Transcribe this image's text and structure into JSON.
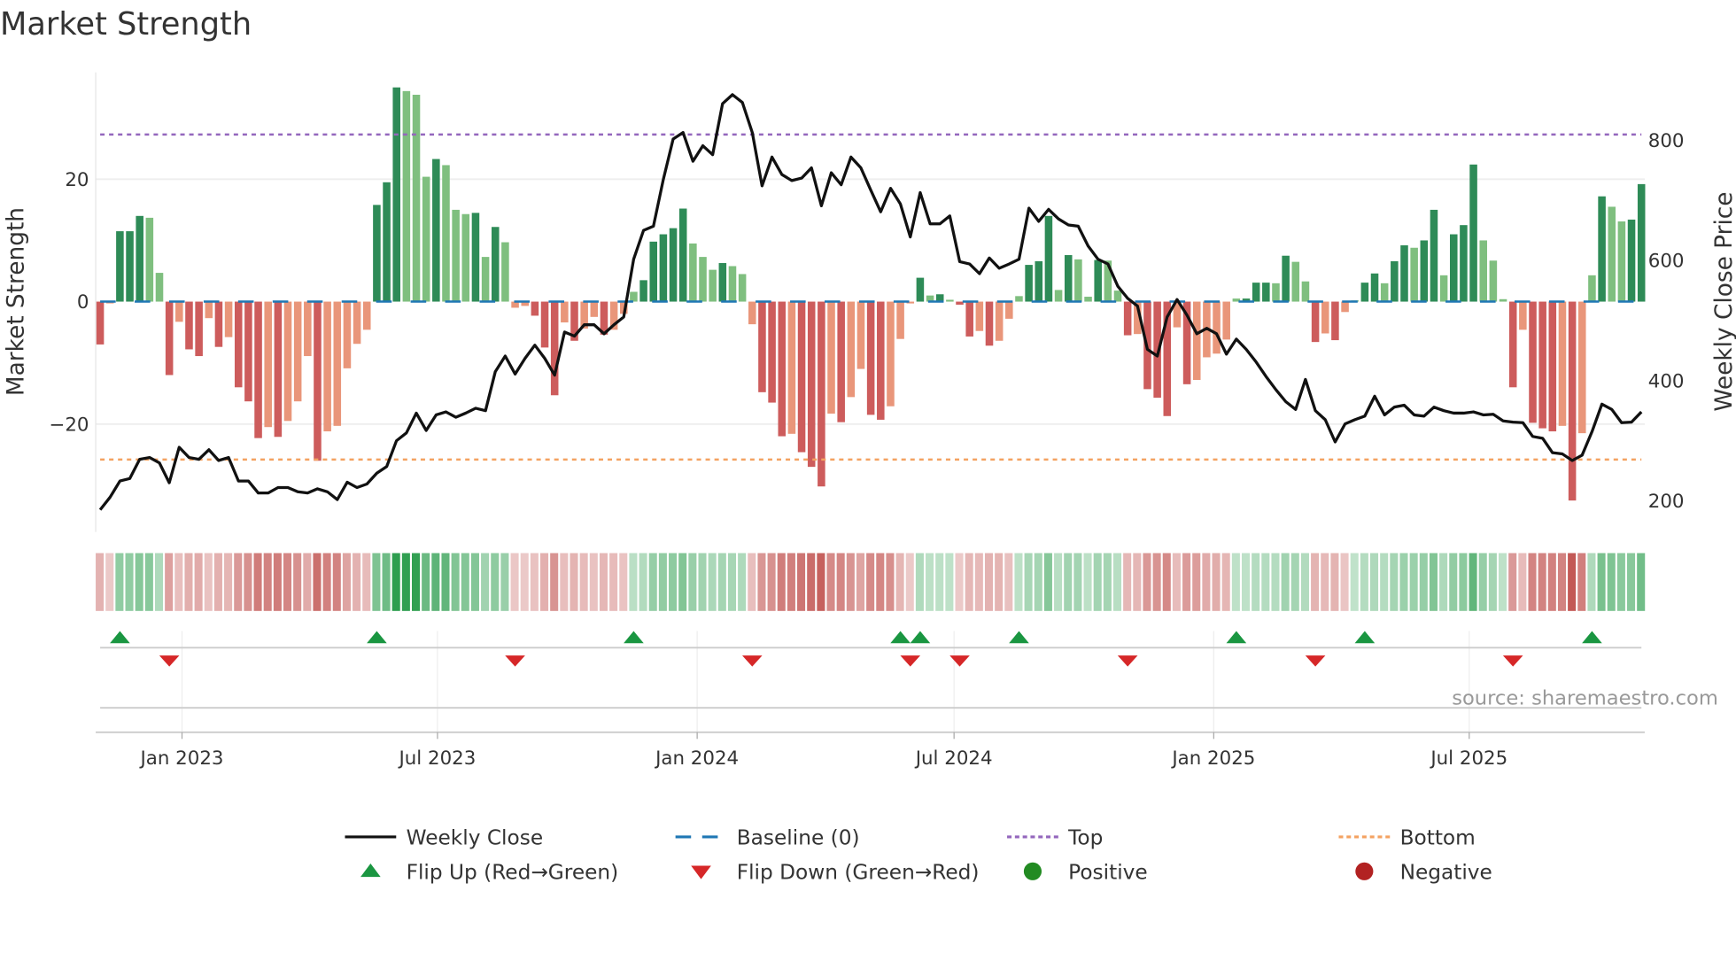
{
  "chart_data": {
    "type": "bar",
    "title": "Market Strength",
    "ylabel": "Market Strength",
    "y2label": "Weekly Close Price",
    "ylim": [
      -37,
      38
    ],
    "y2lim": [
      128,
      1028
    ],
    "x_start": "2022-11-04",
    "x_frequency": "weekly",
    "x_ticks": [
      "Jan 2023",
      "Jul 2023",
      "Jan 2024",
      "Jul 2024",
      "Jan 2025",
      "Jul 2025"
    ],
    "x_tick_dates": [
      "2023-01-01",
      "2023-07-01",
      "2024-01-01",
      "2024-07-01",
      "2025-01-01",
      "2025-07-01"
    ],
    "y_ticks": [
      "−20",
      "0",
      "20"
    ],
    "y_tick_values": [
      -20,
      0,
      20
    ],
    "y2_ticks": [
      "200",
      "400",
      "600",
      "800"
    ],
    "y2_tick_values": [
      200,
      400,
      600,
      800
    ],
    "top_level": 27.3,
    "bottom_level": -25.8,
    "baseline": 0,
    "grid": true,
    "legend_position": "bottom",
    "source_text": "source: sharemaestro.com",
    "series": [
      {
        "name": "Market Strength",
        "type": "bar",
        "values": [
          -7,
          -0.3,
          11.5,
          11.5,
          14,
          13.7,
          4.7,
          -12,
          -3.3,
          -7.8,
          -8.9,
          -2.7,
          -7.4,
          -5.8,
          -14,
          -16.3,
          -22.3,
          -20.5,
          -22.1,
          -19.5,
          -16.3,
          -8.9,
          -26,
          -21.2,
          -20.3,
          -10.9,
          -6.9,
          -4.6,
          15.8,
          19.5,
          35,
          34.4,
          33.8,
          20.4,
          23.3,
          22.3,
          15,
          14.3,
          14.5,
          7.3,
          12.2,
          9.7,
          -1,
          -0.7,
          -2.3,
          -7.5,
          -15.3,
          -3.4,
          -6.4,
          -4.4,
          -2.5,
          -5.4,
          -4.6,
          -2,
          1.6,
          3.5,
          9.8,
          11,
          12,
          15.2,
          9.5,
          7.3,
          5.2,
          6.3,
          5.8,
          4.5,
          -3.7,
          -14.8,
          -16.5,
          -22,
          -21.6,
          -24.6,
          -27,
          -30.2,
          -18.3,
          -19.7,
          -15.6,
          -11,
          -18.5,
          -19.3,
          -17.1,
          -6.1,
          -0.3,
          3.9,
          1,
          1.2,
          0.3,
          -0.5,
          -5.7,
          -4.8,
          -7.2,
          -6.4,
          -2.8,
          0.9,
          6,
          6.6,
          14,
          1.9,
          7.6,
          6.9,
          0.8,
          6.8,
          6.7,
          1.8,
          -5.5,
          -5.3,
          -14.3,
          -15.7,
          -18.7,
          -4.2,
          -13.5,
          -12.8,
          -9.1,
          -8.5,
          -6.2,
          0.5,
          0.5,
          3.1,
          3.1,
          3,
          7.5,
          6.5,
          3.3,
          -6.6,
          -5.2,
          -6.3,
          -1.7,
          0.2,
          3.1,
          4.6,
          3,
          6.6,
          9.2,
          8.8,
          10,
          15,
          4.3,
          11,
          12.5,
          22.4,
          10,
          6.7,
          0.4,
          -14,
          -4.6,
          -19.8,
          -20.7,
          -21.2,
          -20.3,
          -32.5,
          -21.5,
          4.3,
          17.2,
          15.5,
          13.1,
          13.4,
          19.2
        ]
      },
      {
        "name": "Weekly Close",
        "type": "line",
        "axis": "right",
        "values": [
          185,
          206,
          233,
          237,
          269,
          272,
          263,
          230,
          289,
          272,
          269,
          285,
          267,
          272,
          233,
          233,
          213,
          213,
          222,
          222,
          215,
          213,
          220,
          215,
          202,
          231,
          222,
          228,
          246,
          257,
          300,
          313,
          346,
          317,
          343,
          348,
          339,
          346,
          354,
          350,
          415,
          441,
          411,
          437,
          459,
          437,
          409,
          481,
          474,
          493,
          493,
          478,
          493,
          506,
          602,
          650,
          657,
          735,
          802,
          813,
          765,
          791,
          776,
          861,
          876,
          863,
          813,
          724,
          772,
          743,
          733,
          737,
          754,
          691,
          746,
          726,
          772,
          754,
          717,
          681,
          720,
          694,
          639,
          713,
          661,
          661,
          674,
          598,
          594,
          578,
          604,
          587,
          594,
          602,
          687,
          665,
          685,
          669,
          659,
          657,
          624,
          602,
          594,
          557,
          537,
          524,
          452,
          441,
          506,
          535,
          509,
          478,
          487,
          478,
          444,
          469,
          452,
          431,
          407,
          385,
          365,
          352,
          402,
          350,
          335,
          298,
          328,
          335,
          341,
          374,
          343,
          356,
          359,
          343,
          341,
          356,
          350,
          346,
          346,
          348,
          343,
          344,
          333,
          331,
          330,
          307,
          304,
          280,
          278,
          267,
          276,
          315,
          361,
          352,
          330,
          331,
          348
        ]
      }
    ],
    "flip_up_weeks": [
      2,
      28,
      54,
      81,
      83,
      93,
      115,
      128,
      151
    ],
    "flip_down_weeks": [
      7,
      42,
      66,
      82,
      87,
      104,
      123,
      143
    ],
    "legend": [
      {
        "label": "Weekly Close",
        "symbol": "line-solid",
        "color": "#111111"
      },
      {
        "label": "Baseline (0)",
        "symbol": "line-dashed",
        "color": "#1f77b4"
      },
      {
        "label": "Top",
        "symbol": "line-dotted",
        "color": "#9467bd"
      },
      {
        "label": "Bottom",
        "symbol": "line-dotted",
        "color": "#f4a261"
      },
      {
        "label": "Flip Up (Red→Green)",
        "symbol": "triangle-up",
        "color": "#1a9641"
      },
      {
        "label": "Flip Down (Green→Red)",
        "symbol": "triangle-down",
        "color": "#d62728"
      },
      {
        "label": "Positive",
        "symbol": "circle",
        "color": "#228b22"
      },
      {
        "label": "Negative",
        "symbol": "circle",
        "color": "#b22222"
      }
    ],
    "colors": {
      "pos_strong": "#2e8b57",
      "pos_weak": "#7fbf7f",
      "neg_strong": "#cd5c5c",
      "neg_weak": "#e9967a",
      "top": "#9467bd",
      "bottom": "#f4a261",
      "baseline": "#1f77b4",
      "flip_up": "#1a9641",
      "flip_down": "#d62728"
    }
  }
}
